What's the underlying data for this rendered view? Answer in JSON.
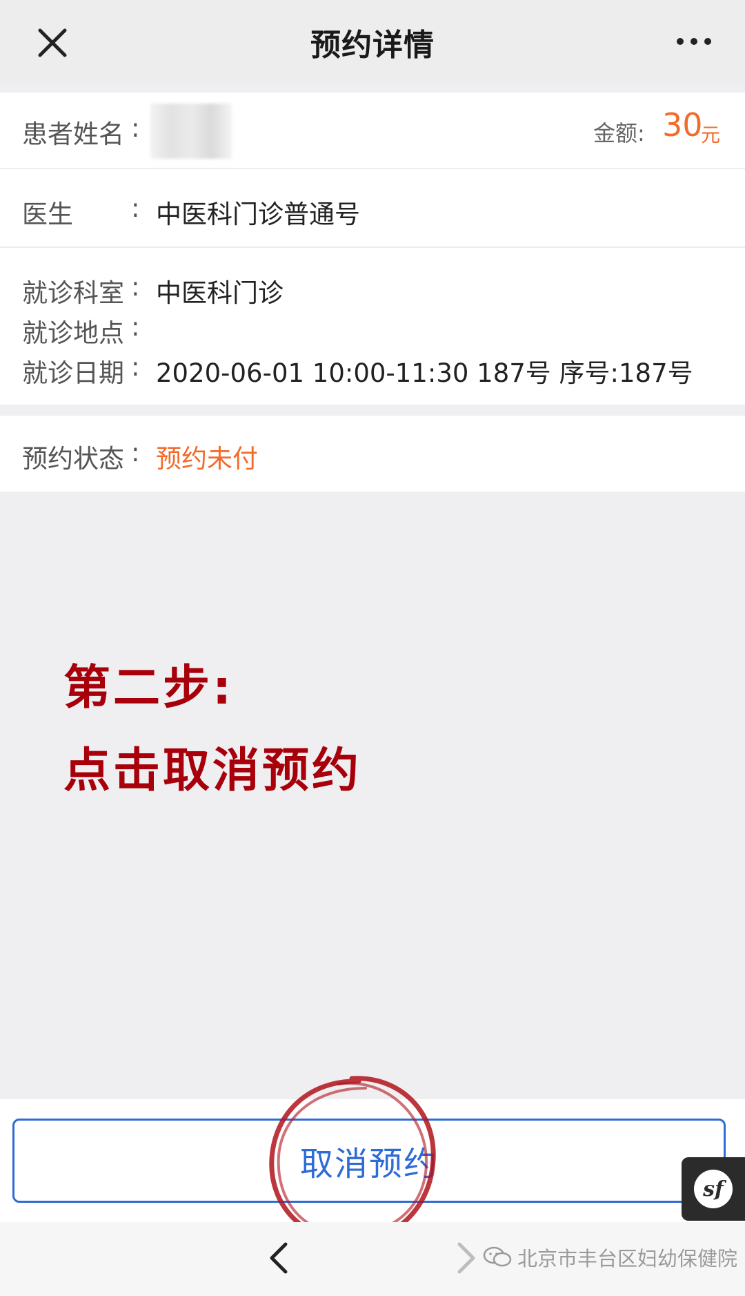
{
  "header": {
    "title": "预约详情",
    "close_icon": "close-icon",
    "more_icon": "more-icon"
  },
  "patient": {
    "name_label": "患者姓名",
    "amount_label": "金额:",
    "amount_value": "30",
    "amount_unit": "元"
  },
  "doctor": {
    "label": "医生",
    "value": "中医科门诊普通号"
  },
  "visit": {
    "dept_label": "就诊科室",
    "dept_value": "中医科门诊",
    "location_label": "就诊地点",
    "location_value": "",
    "date_label": "就诊日期",
    "date_value": "2020-06-01 10:00-11:30 187号 序号:187号"
  },
  "status": {
    "label": "预约状态",
    "value": "预约未付"
  },
  "annotation": {
    "line1": "第二步:",
    "line2": "点击取消预约"
  },
  "actions": {
    "cancel_label": "取消预约"
  },
  "footer": {
    "watermark": "北京市丰台区妇幼保健院",
    "sf_label": "sf"
  },
  "colors": {
    "accent_orange": "#f26b2a",
    "annotation_red": "#a8000a",
    "button_blue": "#2d6bd6"
  }
}
